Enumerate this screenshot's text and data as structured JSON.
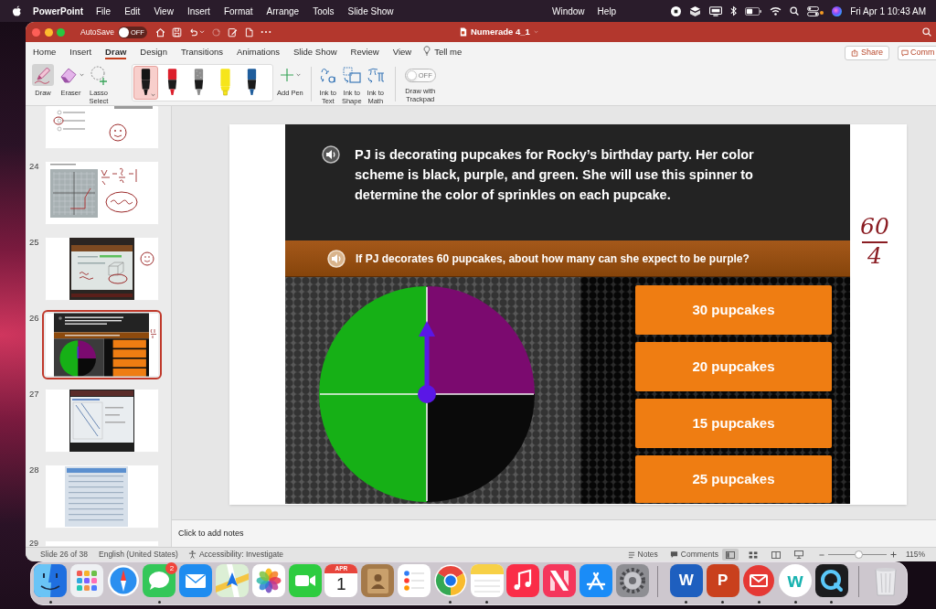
{
  "menu_bar": {
    "app_name": "PowerPoint",
    "menus": [
      "File",
      "Edit",
      "View",
      "Insert",
      "Format",
      "Arrange",
      "Tools",
      "Slide Show"
    ],
    "right_menus": [
      "Window",
      "Help"
    ],
    "clock": "Fri Apr 1 10:43 AM"
  },
  "title_bar": {
    "autosave_label": "AutoSave",
    "autosave_on": false,
    "autosave_state": "OFF",
    "document_title": "Numerade 4_1"
  },
  "ribbon_tabs": [
    {
      "label": "Home",
      "selected": false
    },
    {
      "label": "Insert",
      "selected": false
    },
    {
      "label": "Draw",
      "selected": true
    },
    {
      "label": "Design",
      "selected": false
    },
    {
      "label": "Transitions",
      "selected": false
    },
    {
      "label": "Animations",
      "selected": false
    },
    {
      "label": "Slide Show",
      "selected": false
    },
    {
      "label": "Review",
      "selected": false
    },
    {
      "label": "View",
      "selected": false
    }
  ],
  "tell_me": "Tell me",
  "header_buttons": [
    {
      "kind": "share",
      "label": "Share"
    },
    {
      "kind": "comments",
      "label": "Comm"
    }
  ],
  "draw_tools": [
    {
      "kind": "draw",
      "label": "Draw",
      "selected": true
    },
    {
      "kind": "eraser",
      "label": "Eraser",
      "selected": false
    },
    {
      "kind": "lasso",
      "label": "Lasso Select",
      "selected": false
    }
  ],
  "pens": [
    {
      "kind": "pen",
      "color": "#151515",
      "selected": true
    },
    {
      "kind": "pen",
      "color": "#dc1f2b",
      "selected": false
    },
    {
      "kind": "pencil",
      "color": "#8d8d8d",
      "selected": false
    },
    {
      "kind": "highlighter",
      "color": "#f6e51a",
      "selected": false
    },
    {
      "kind": "pen",
      "color": "#1f5d9c",
      "selected": false
    }
  ],
  "add_pen": "Add Pen",
  "ink_tools": [
    {
      "kind": "text",
      "label": "Ink to Text"
    },
    {
      "kind": "shape",
      "label": "Ink to Shape"
    },
    {
      "kind": "math",
      "label": "Ink to Math"
    }
  ],
  "trackpad": {
    "label": "Draw with Trackpad",
    "on": false,
    "state": "OFF"
  },
  "slide_thumbnails": [
    {
      "kind": "ink_options",
      "selected": false
    },
    {
      "number": "24",
      "kind": "graph_photo",
      "selected": false
    },
    {
      "number": "25",
      "kind": "screen_photo",
      "selected": false
    },
    {
      "number": "26",
      "kind": "spinner_slide",
      "selected": true
    },
    {
      "number": "27",
      "kind": "graph_screen_photo",
      "selected": false
    },
    {
      "number": "28",
      "kind": "worksheet_photo",
      "selected": false
    },
    {
      "number": "29",
      "kind": "blank",
      "selected": false
    }
  ],
  "slide": {
    "question": "PJ is decorating pupcakes for Rocky’s birthday party. Her color scheme is black, purple, and green. She will use this spinner to determine the color of sprinkles on each pupcake.",
    "prompt": "If PJ decorates 60 pupcakes, about how many can she expect to be purple?",
    "spinner_sections": [
      {
        "color": "#7b0a6f"
      },
      {
        "color": "#0a0a0a"
      },
      {
        "color": "#16b016"
      },
      {
        "color": "#16b016"
      }
    ],
    "answers": [
      "30 pupcakes",
      "20 pupcakes",
      "15 pupcakes",
      "25 pupcakes"
    ],
    "ink_note": {
      "numerator": "60",
      "denominator": "4"
    }
  },
  "notes_placeholder": "Click to add notes",
  "status_bar": {
    "slide_position": "Slide 26 of 38",
    "language": "English (United States)",
    "accessibility": "Accessibility: Investigate",
    "notes": "Notes",
    "comments": "Comments",
    "views": [
      {
        "kind": "normal",
        "selected": true
      },
      {
        "kind": "sorter",
        "selected": false
      },
      {
        "kind": "reading",
        "selected": false
      },
      {
        "kind": "presenter",
        "selected": false
      }
    ],
    "zoom": {
      "level": 0.53,
      "label": "115%"
    }
  },
  "dock": {
    "apps": [
      {
        "kind": "finder",
        "running": true
      },
      {
        "kind": "launchpad",
        "running": false
      },
      {
        "kind": "safari",
        "running": false
      },
      {
        "kind": "messages",
        "running": true,
        "badge": "2"
      },
      {
        "kind": "mail",
        "running": false
      },
      {
        "kind": "maps",
        "running": false
      },
      {
        "kind": "photos",
        "running": false
      },
      {
        "kind": "facetime",
        "running": false
      },
      {
        "kind": "calendar",
        "running": false,
        "month": "APR",
        "day": "1"
      },
      {
        "kind": "contacts",
        "running": false
      },
      {
        "kind": "reminders",
        "running": false
      },
      {
        "kind": "chrome",
        "running": true
      },
      {
        "kind": "notes",
        "running": true
      },
      {
        "kind": "music",
        "running": false
      },
      {
        "kind": "news",
        "running": false
      },
      {
        "kind": "app_store",
        "running": false
      },
      {
        "kind": "system_preferences",
        "running": false
      }
    ],
    "recent": [
      {
        "kind": "word",
        "running": true,
        "letter": "W"
      },
      {
        "kind": "powerpoint",
        "running": true,
        "letter": "P"
      },
      {
        "kind": "mail_app",
        "running": true
      },
      {
        "kind": "numerade",
        "running": true,
        "letter": "w"
      },
      {
        "kind": "quicktime",
        "running": true
      }
    ],
    "trash": [
      {
        "kind": "trash",
        "running": false
      }
    ]
  }
}
